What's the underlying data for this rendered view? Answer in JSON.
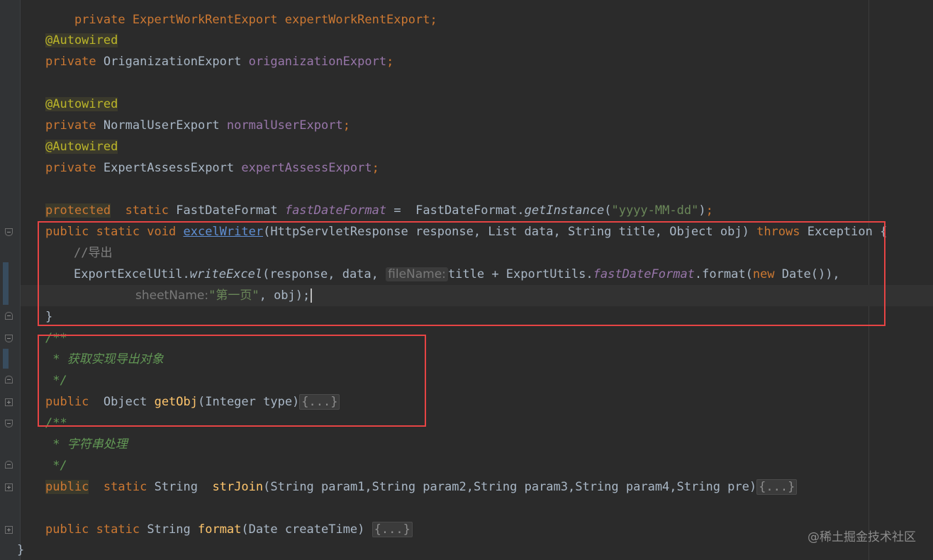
{
  "colors": {
    "background": "#2b2b2b",
    "keyword": "#cc7832",
    "annotation": "#bbb529",
    "field": "#9876aa",
    "string": "#6a8759",
    "comment": "#808080",
    "doc_comment": "#629755",
    "method": "#ffc66d",
    "highlight_box": "#e64444"
  },
  "icons": [
    "fold-collapse-icon",
    "fold-expand-icon"
  ],
  "code": {
    "l0_decl": "private ExpertWorkRentExport expertWorkRentExport;",
    "l2_ann": "@Autowired",
    "l3_kw": "private",
    "l3_type": "OriganizationExport",
    "l3_field": "origanizationExport",
    "l5_ann": "@Autowired",
    "l6_kw": "private",
    "l6_type": "NormalUserExport",
    "l6_field": "normalUserExport",
    "l7_ann": "@Autowired",
    "l8_kw": "private",
    "l8_type": "ExpertAssessExport",
    "l8_field": "expertAssessExport",
    "l10_kw1": "protected",
    "l10_kw2": "static",
    "l10_type": "FastDateFormat",
    "l10_field": "fastDateFormat",
    "l10_op": "=",
    "l10_cls": "FastDateFormat.",
    "l10_method": "getInstance",
    "l10_str": "\"yyyy-MM-dd\"",
    "l11_kw": "public static void",
    "l11_method": "excelWriter",
    "l11_params": "(HttpServletResponse response, List data, String title, Object obj)",
    "l11_throws": "throws",
    "l11_tail": "Exception {",
    "l12_comment": "//导出",
    "l13_cls": "ExportExcelUtil.",
    "l13_method": "writeExcel",
    "l13_args1": "(response, data,",
    "l13_hint": "fileName:",
    "l13_args2": "title + ExportUtils.",
    "l13_field": "fastDateFormat",
    "l13_args3": ".format(",
    "l13_new": "new",
    "l13_args4": "Date()),",
    "l14_hint": "sheetName:",
    "l14_str": "\"第一页\"",
    "l14_args": ", obj);",
    "l15_brace": "}",
    "l16_doc": "/**",
    "l17_doc": " * 获取实现导出对象",
    "l18_doc": " */",
    "l19_kw": "public",
    "l19_type": "Object",
    "l19_method": "getObj",
    "l19_params": "(Integer type)",
    "l19_fold": "{...}",
    "l20_doc": "/**",
    "l21_doc": " * 字符串处理",
    "l22_doc": " */",
    "l23_kw1": "public",
    "l23_kw2": "static",
    "l23_type": "String",
    "l23_method": "strJoin",
    "l23_params": "(String param1,String param2,String param3,String param4,String pre)",
    "l23_fold": "{...}",
    "l25_kw": "public static",
    "l25_type": "String",
    "l25_method": "format",
    "l25_params": "(Date createTime)",
    "l25_fold": "{...}",
    "l26_brace": "}"
  },
  "watermark": "@稀土掘金技术社区"
}
